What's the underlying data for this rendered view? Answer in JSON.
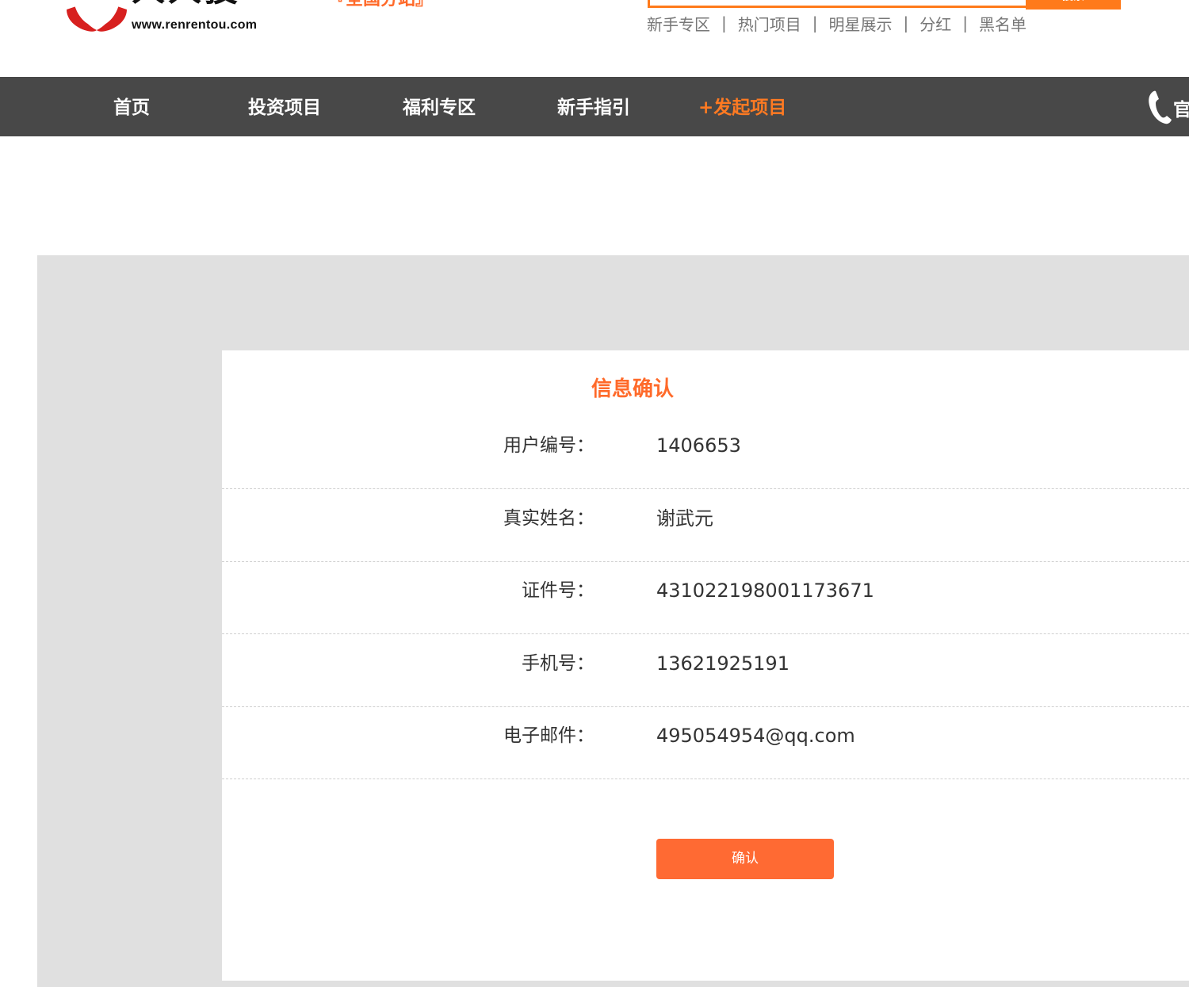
{
  "header": {
    "logo_cn": "人人投",
    "logo_url": "www.renrentou.com",
    "subsite": "『全国分站』",
    "search_button": "搜索",
    "quick_links": [
      "新手专区",
      "热门项目",
      "明星展示",
      "分红",
      "黑名单"
    ],
    "separator": "|"
  },
  "nav": {
    "items": [
      "首页",
      "投资项目",
      "福利专区",
      "新手指引",
      "+发起项目"
    ],
    "phone_text": "官"
  },
  "colors": {
    "accent": "#ff6a2a",
    "nav_bg": "#484848",
    "panel_bg": "#e0e0e0"
  },
  "card": {
    "title": "信息确认",
    "rows": [
      {
        "label": "用户编号：",
        "value": "1406653"
      },
      {
        "label": "真实姓名：",
        "value": "谢武元"
      },
      {
        "label": "证件号：",
        "value": "431022198001173671"
      },
      {
        "label": "手机号：",
        "value": "13621925191"
      },
      {
        "label": "电子邮件：",
        "value": "495054954@qq.com"
      }
    ],
    "confirm_button": "确认"
  }
}
